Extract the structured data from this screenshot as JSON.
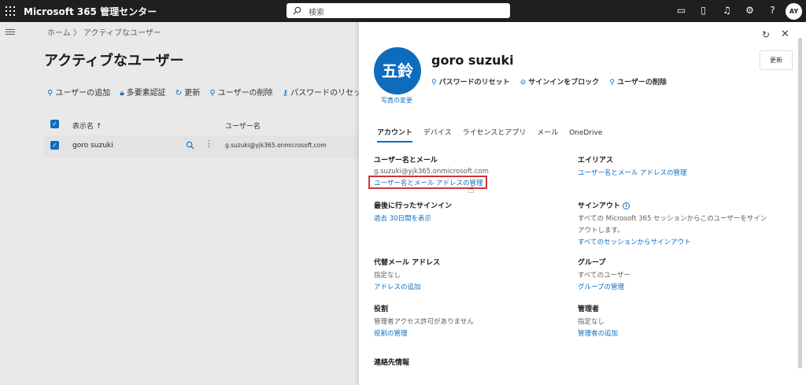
{
  "topbar": {
    "title": "Microsoft 365 管理センター",
    "search_placeholder": "検索",
    "avatar": "AY",
    "help": "?"
  },
  "breadcrumb": "ホーム 〉 アクティブなユーザー",
  "page_title": "アクティブなユーザー",
  "commands": [
    {
      "label": "ユーザーの追加",
      "icon": "person-add-icon"
    },
    {
      "label": "多要素認証",
      "icon": "lock-icon"
    },
    {
      "label": "更新",
      "icon": "refresh-icon"
    },
    {
      "label": "ユーザーの削除",
      "icon": "person-remove-icon"
    },
    {
      "label": "パスワードのリセット",
      "icon": "key-icon"
    }
  ],
  "table": {
    "col_display_name": "表示名 ↑",
    "col_username": "ユーザー名",
    "row": {
      "name": "goro suzuki",
      "email": "g.suzuki@yjk365.onmicrosoft.com"
    }
  },
  "panel": {
    "update_label": "更新",
    "avatar_initials": "五鈴",
    "change_photo": "写真の変更",
    "user_name": "goro suzuki",
    "actions": [
      "パスワードのリセット",
      "サインインをブロック",
      "ユーザーの削除"
    ],
    "tabs": [
      "アカウント",
      "デバイス",
      "ライセンスとアプリ",
      "メール",
      "OneDrive"
    ],
    "sections": {
      "username_email": {
        "title": "ユーザー名とメール",
        "value": "g.suzuki@yjk365.onmicrosoft.com",
        "link": "ユーザー名とメール アドレスの管理"
      },
      "alias": {
        "title": "エイリアス",
        "link": "ユーザー名とメール アドレスの管理"
      },
      "last_signin": {
        "title": "最後に行ったサインイン",
        "link": "過去 30日間を表示"
      },
      "signout": {
        "title": "サインアウト",
        "value_line1": "すべての Microsoft 365 セッションからこのユーザーをサイン",
        "value_line2": "アウトします。",
        "link": "すべてのセッションからサインアウト"
      },
      "alt_email": {
        "title": "代替メール アドレス",
        "value": "指定なし",
        "link": "アドレスの追加"
      },
      "groups": {
        "title": "グループ",
        "value": "すべてのユーザー",
        "link": "グループの管理"
      },
      "roles": {
        "title": "役割",
        "value": "管理者アクセス許可がありません",
        "link": "役割の管理"
      },
      "manager": {
        "title": "管理者",
        "value": "指定なし",
        "link": "管理者の追加"
      },
      "contact": {
        "title": "連絡先情報"
      }
    }
  },
  "colors": {
    "accent": "#0f6cbd",
    "topbar": "#1f1f1f",
    "highlight": "#d13438"
  }
}
